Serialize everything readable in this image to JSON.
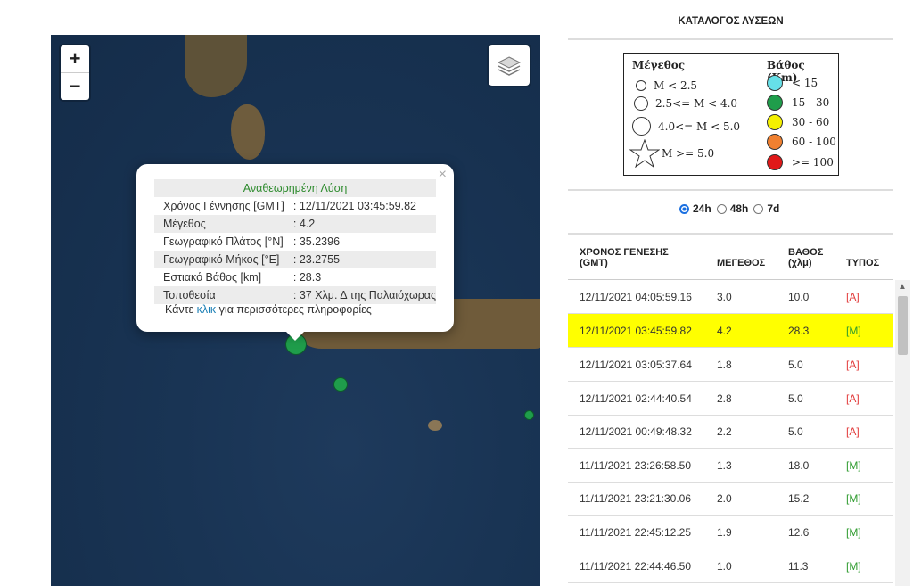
{
  "map": {
    "zoom_in": "+",
    "zoom_out": "−",
    "popup": {
      "close": "×",
      "title": "Αναθεωρημένη Λύση",
      "rows": [
        {
          "label": "Χρόνος Γέννησης [GMT]",
          "value": ": 12/11/2021 03:45:59.82"
        },
        {
          "label": "Μέγεθος",
          "value": ": 4.2"
        },
        {
          "label": "Γεωγραφικό Πλάτος [°N]",
          "value": ": 35.2396"
        },
        {
          "label": "Γεωγραφικό Μήκος [°E]",
          "value": ": 23.2755"
        },
        {
          "label": "Εστιακό Βάθος [km]",
          "value": ": 28.3"
        },
        {
          "label": "Τοποθεσία",
          "value": ": 37 Χλμ. Δ της Παλαιόχωρας"
        }
      ],
      "more_prefix": "Κάντε ",
      "more_link": "κλικ",
      "more_suffix": " για περισσότερες πληροφορίες"
    }
  },
  "panel": {
    "title": "ΚΑΤΑΛΟΓΟΣ ΛΥΣΕΩΝ",
    "legend": {
      "magnitude_header": "Μέγεθος",
      "depth_header": "Βάθος (Km)",
      "magnitudes": [
        "M < 2.5",
        "2.5<= M < 4.0",
        "4.0<= M < 5.0",
        "M >= 5.0"
      ],
      "depths": [
        {
          "label": "< 15",
          "color": "#66e0e8"
        },
        {
          "label": "15 - 30",
          "color": "#1f9d4b"
        },
        {
          "label": "30 - 60",
          "color": "#f5f000"
        },
        {
          "label": "60 - 100",
          "color": "#f08030"
        },
        {
          "label": ">= 100",
          "color": "#e01818"
        }
      ]
    },
    "periods": [
      "24h",
      "48h",
      "7d"
    ],
    "selected_period": "24h",
    "columns": {
      "time": "ΧΡΟΝΟΣ ΓΕΝΕΣΗΣ",
      "time_unit": "(GMT)",
      "mag": "ΜΕΓΕΘΟΣ",
      "depth": "ΒΑΘΟΣ",
      "depth_unit": "(χλμ)",
      "type": "ΤΥΠΟΣ"
    },
    "rows": [
      {
        "time": "12/11/2021 04:05:59.16",
        "mag": "3.0",
        "depth": "10.0",
        "type": "[A]"
      },
      {
        "time": "12/11/2021 03:45:59.82",
        "mag": "4.2",
        "depth": "28.3",
        "type": "[M]"
      },
      {
        "time": "12/11/2021 03:05:37.64",
        "mag": "1.8",
        "depth": "5.0",
        "type": "[A]"
      },
      {
        "time": "12/11/2021 02:44:40.54",
        "mag": "2.8",
        "depth": "5.0",
        "type": "[A]"
      },
      {
        "time": "12/11/2021 00:49:48.32",
        "mag": "2.2",
        "depth": "5.0",
        "type": "[A]"
      },
      {
        "time": "11/11/2021 23:26:58.50",
        "mag": "1.3",
        "depth": "18.0",
        "type": "[M]"
      },
      {
        "time": "11/11/2021 23:21:30.06",
        "mag": "2.0",
        "depth": "15.2",
        "type": "[M]"
      },
      {
        "time": "11/11/2021 22:45:12.25",
        "mag": "1.9",
        "depth": "12.6",
        "type": "[M]"
      },
      {
        "time": "11/11/2021 22:44:46.50",
        "mag": "1.0",
        "depth": "11.3",
        "type": "[M]"
      }
    ],
    "highlight_color": "#ffff00"
  }
}
